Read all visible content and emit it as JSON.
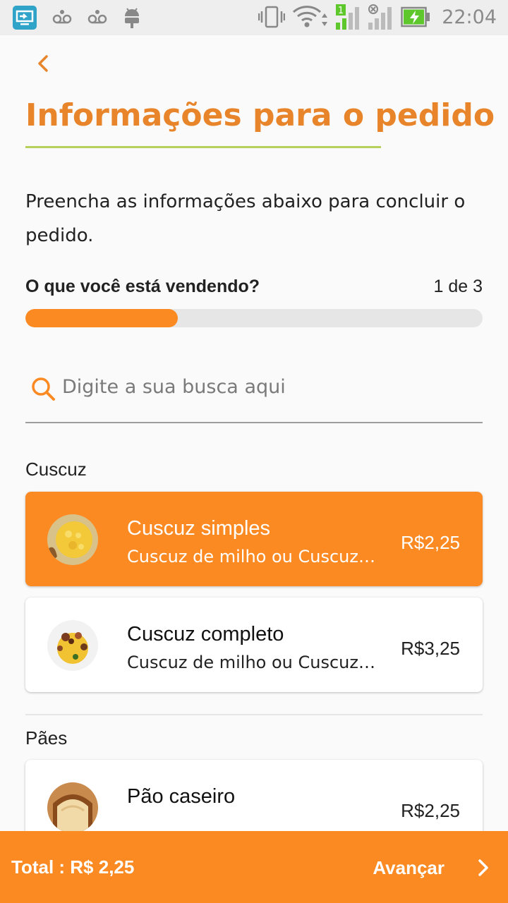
{
  "status_bar": {
    "time": "22:04",
    "icons": [
      "screen-cast-icon",
      "voicemail-icon",
      "voicemail-icon",
      "android-icon",
      "vibrate-icon",
      "wifi-icon",
      "signal-sim1-icon",
      "signal-no-sim-icon",
      "battery-charging-icon"
    ],
    "sim_badge": "1"
  },
  "header": {
    "back_icon": "chevron-left-icon",
    "title": "Informações para o pedido",
    "intro": "Preencha as informações abaixo para concluir o pedido."
  },
  "progress": {
    "label": "O que você está vendendo?",
    "count": "1 de 3",
    "fraction": 0.333
  },
  "search": {
    "placeholder": "Digite a sua busca aqui",
    "value": ""
  },
  "categories": [
    {
      "title": "Cuscuz",
      "items": [
        {
          "name": "Cuscuz simples",
          "description": "Cuscuz de milho ou Cuscuz de arroz",
          "price": "R$2,25",
          "selected": true,
          "image": "cuscuz-simples-photo"
        },
        {
          "name": "Cuscuz completo",
          "description": "Cuscuz de milho ou Cuscuz de arroz",
          "price": "R$3,25",
          "selected": false,
          "image": "cuscuz-completo-photo"
        }
      ]
    },
    {
      "title": "Pães",
      "items": [
        {
          "name": "Pão caseiro",
          "description": "",
          "price": "R$2,25",
          "selected": false,
          "image": "pao-caseiro-photo"
        }
      ]
    }
  ],
  "footer": {
    "total": "Total : R$ 2,25",
    "advance_label": "Avançar",
    "advance_icon": "chevron-right-icon"
  },
  "colors": {
    "accent": "#fc8a23",
    "title": "#e8852a",
    "title_underline": "#b7cf5b",
    "status_bar": "#eeeeee",
    "background": "#fafafa",
    "battery": "#5ec72b"
  }
}
